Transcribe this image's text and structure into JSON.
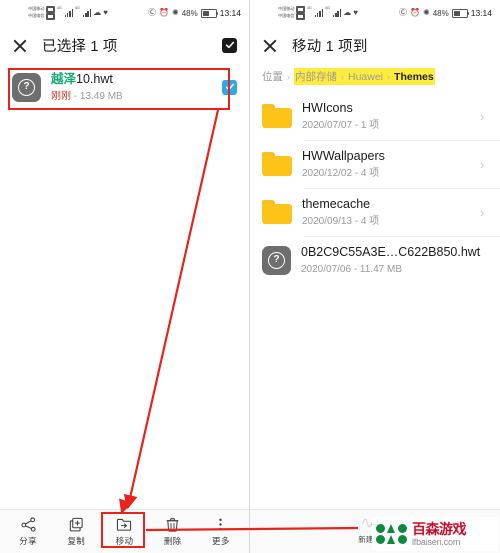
{
  "status_bar": {
    "carrier_primary": "中国移动",
    "carrier_secondary": "中国电信",
    "battery_percent": "48%",
    "time": "13:14",
    "icons": [
      "hd-icon",
      "alarm-icon",
      "bluetooth-icon",
      "wifi-icon",
      "signal-bars-icon",
      "vpn-icon"
    ]
  },
  "left_screen": {
    "appbar": {
      "close_label": "×",
      "title": "已选择 1 项",
      "select_all_name": "select-all-checkbox"
    },
    "file": {
      "name_highlight": "越泽",
      "name_rest": "10.hwt",
      "time": "刚刚",
      "separator": " - ",
      "size": "13.49 MB",
      "icon": "unknown-file-icon",
      "checked": true
    },
    "toolbar": [
      {
        "label": "分享",
        "icon": "share-icon",
        "highlighted": false
      },
      {
        "label": "复制",
        "icon": "copy-icon",
        "highlighted": false
      },
      {
        "label": "移动",
        "icon": "move-icon",
        "highlighted": true
      },
      {
        "label": "删除",
        "icon": "delete-icon",
        "highlighted": false
      },
      {
        "label": "更多",
        "icon": "more-icon",
        "highlighted": false
      }
    ]
  },
  "right_screen": {
    "appbar": {
      "close_label": "×",
      "title": "移动 1 项到"
    },
    "breadcrumb": {
      "location_label": "位置",
      "separator": "›",
      "segments": [
        "内部存储",
        "Huawei",
        "Themes"
      ],
      "current": "Themes",
      "highlight_color": "#ffec3d"
    },
    "items": [
      {
        "type": "folder",
        "name": "HWIcons",
        "meta": "2020/07/07 - 1 项",
        "chevron": "›"
      },
      {
        "type": "folder",
        "name": "HWWallpapers",
        "meta": "2020/12/02 - 4 项",
        "chevron": "›"
      },
      {
        "type": "folder",
        "name": "themecache",
        "meta": "2020/09/13 - 4 项",
        "chevron": "›"
      },
      {
        "type": "file",
        "name": "0B2C9C55A3E…C622B850.hwt",
        "meta": "2020/07/06 - 11.47 MB",
        "chevron": ""
      }
    ],
    "bottom": {
      "new_folder_label": "新建文件夹",
      "new_folder_icon": "plus-icon"
    }
  },
  "annotations": {
    "color": "#e8231a",
    "boxes": [
      "selected-file-row",
      "move-toolbar-button"
    ],
    "arrows": [
      "file-row-to-move-button",
      "move-button-to-new-folder"
    ]
  },
  "watermark": {
    "brand_cn": "百森游戏",
    "brand_url": "lfbaisen.com",
    "brand_color": "#c8102e",
    "logo_color": "#0b8a3c"
  }
}
